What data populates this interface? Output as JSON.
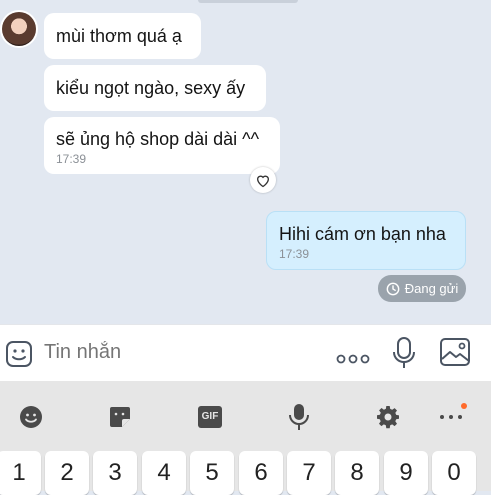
{
  "messages": [
    {
      "text": "mùi thơm quá ạ"
    },
    {
      "text": "kiểu ngọt ngào, sexy ấy"
    },
    {
      "text": "sẽ ủng hộ shop dài dài ^^",
      "time": "17:39"
    }
  ],
  "my_message": {
    "text": "Hihi cám ơn bạn nha",
    "time": "17:39"
  },
  "send_status": "Đang gửi",
  "input": {
    "placeholder": "Tin nhắn"
  },
  "keyboard": {
    "gif_label": "GIF",
    "number_keys": [
      "1",
      "2",
      "3",
      "4",
      "5",
      "6",
      "7",
      "8",
      "9",
      "0"
    ]
  },
  "colors": {
    "my_bubble": "#d5effe",
    "chat_bg": "#e2e8f1",
    "notification_dot": "#ff6a2b"
  }
}
